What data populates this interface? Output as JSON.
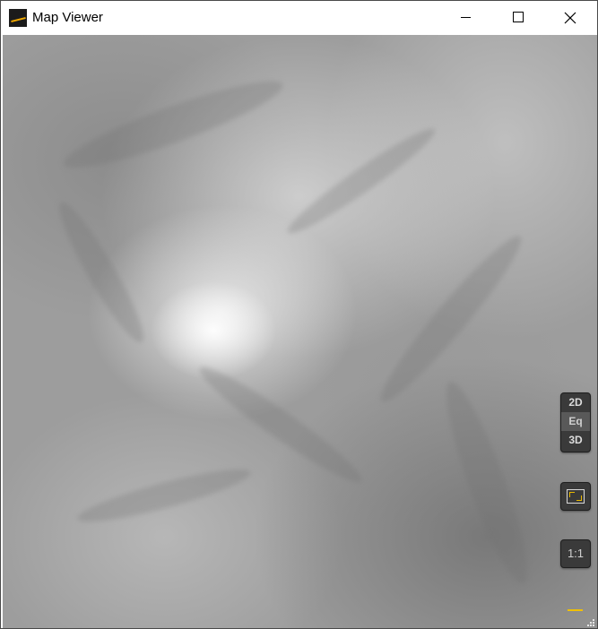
{
  "window": {
    "title": "Map Viewer",
    "controls": {
      "minimize_icon": "minimize-icon",
      "maximize_icon": "maximize-icon",
      "close_icon": "close-icon"
    }
  },
  "map": {
    "type": "grayscale-elevation-hillshade",
    "view_modes": [
      "2D",
      "Eq",
      "3D"
    ],
    "selected_view_mode": "Eq",
    "fit_icon": "fit-to-window-icon",
    "one_to_one_label": "1:1",
    "scale_bar_color": "#f0c000",
    "accent": "#e8b800"
  }
}
